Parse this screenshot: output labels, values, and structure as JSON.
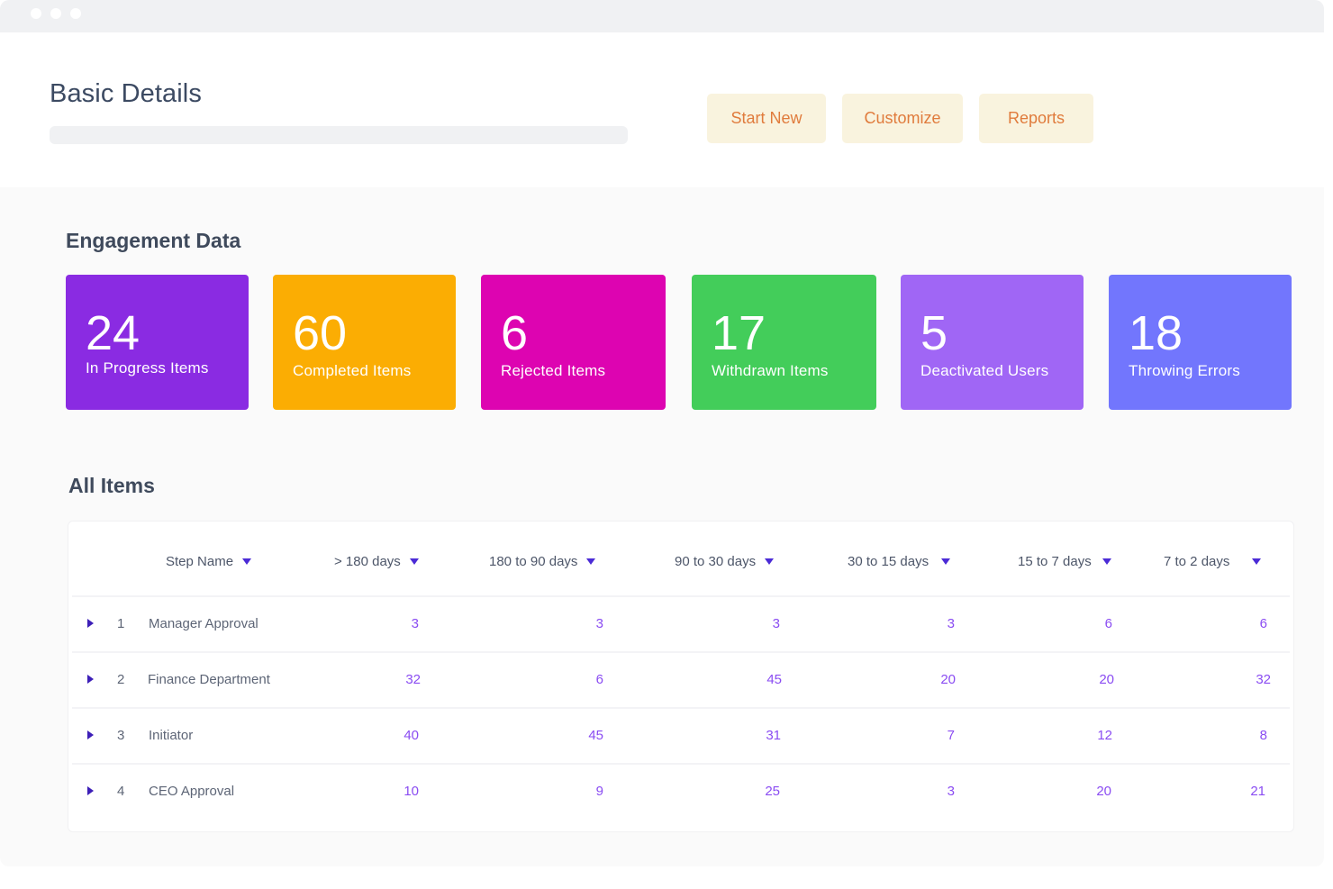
{
  "window": {
    "titlebar_dots": 3
  },
  "header": {
    "title": "Basic Details",
    "buttons": [
      {
        "label": "Start New"
      },
      {
        "label": "Customize"
      },
      {
        "label": "Reports"
      }
    ]
  },
  "engagement": {
    "title": "Engagement Data",
    "cards": [
      {
        "value": "24",
        "label": "In Progress Items",
        "color": "#8a2be2"
      },
      {
        "value": "60",
        "label": "Completed Items",
        "color": "#fbad03"
      },
      {
        "value": "6",
        "label": "Rejected Items",
        "color": "#dd04b1"
      },
      {
        "value": "17",
        "label": "Withdrawn Items",
        "color": "#43cd5a"
      },
      {
        "value": "5",
        "label": "Deactivated Users",
        "color": "#a066f5"
      },
      {
        "value": "18",
        "label": "Throwing Errors",
        "color": "#7276fd"
      }
    ]
  },
  "all_items": {
    "title": "All Items",
    "columns": [
      "Step Name",
      "> 180 days",
      "180 to 90 days",
      "90 to 30 days",
      "30 to 15 days",
      "15 to 7 days",
      "7 to 2 days"
    ],
    "rows": [
      {
        "num": "1",
        "name": "Manager Approval",
        "values": [
          "3",
          "3",
          "3",
          "3",
          "6",
          "6"
        ]
      },
      {
        "num": "2",
        "name": "Finance Department",
        "values": [
          "32",
          "6",
          "45",
          "20",
          "20",
          "32"
        ]
      },
      {
        "num": "3",
        "name": "Initiator",
        "values": [
          "40",
          "45",
          "31",
          "7",
          "12",
          "8"
        ]
      },
      {
        "num": "4",
        "name": "CEO Approval",
        "values": [
          "10",
          "9",
          "25",
          "3",
          "20",
          "21"
        ]
      }
    ]
  },
  "icons": {
    "sort": "caret-down-icon",
    "expand": "caret-right-icon"
  }
}
